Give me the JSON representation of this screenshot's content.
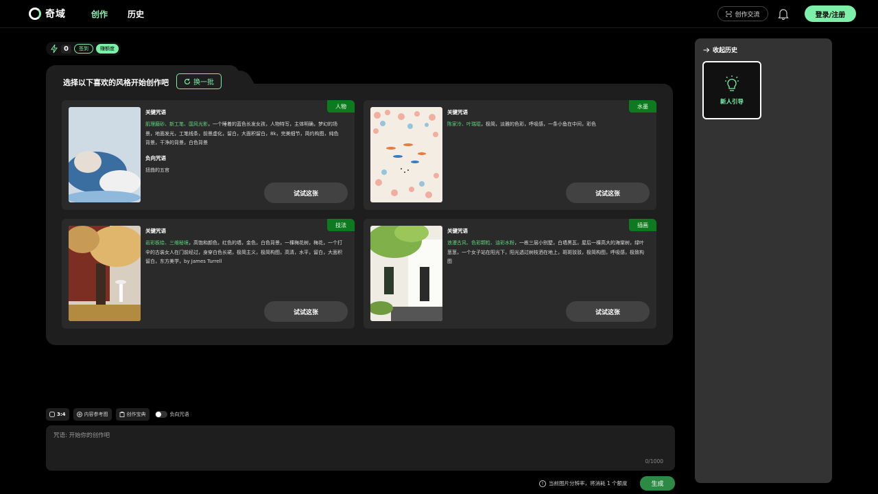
{
  "header": {
    "app_name": "奇域",
    "nav": [
      {
        "label": "创作"
      },
      {
        "label": "历史"
      }
    ],
    "exchange_label": "创作交流",
    "login_label": "登录/注册"
  },
  "credits": {
    "count": "0",
    "checkin_label": "签到",
    "quota_label": "赚额度"
  },
  "panel": {
    "title": "选择以下喜欢的风格开始创作吧",
    "refresh_label": "换一批",
    "cards": [
      {
        "tag": "人物",
        "keyword_label": "关键咒语",
        "keyword_highlight": "肌理磨砂、新工笔、国风光影",
        "keyword_text": "，一个睡着的蓝色长发女孩，人物特写，主体明确，梦幻的场景，地面发光，工笔线条，前景虚化，留白，大面积留白，8k，完美细节，简约构图，纯色背景，干净的背景，白色背景",
        "negative_label": "负向咒语",
        "negative_text": "扭曲的五官",
        "try_label": "试试这张"
      },
      {
        "tag": "水墨",
        "keyword_label": "关键咒语",
        "keyword_highlight": "陈家泠、叶瑞琨",
        "keyword_text": "，极简，淡雅的色彩，呼吸感，一条小鱼在中间，彩色",
        "try_label": "试试这张"
      },
      {
        "tag": "技法",
        "keyword_label": "关键咒语",
        "keyword_highlight": "岩彩板绘、三维秘境",
        "keyword_text": "，高饱和颜色，红色的墙，金色，白色背景，一棵梅花树，梅花，一个打伞的古装女人在门前经过，身穿白色长裙，极简主义，极简构图，高清，水平，留白，大面积留白，东方美学，by James Turrell",
        "try_label": "试试这张"
      },
      {
        "tag": "插画",
        "keyword_label": "关键咒语",
        "keyword_highlight": "浪漫古风、色彩颗粒、油彩水粉",
        "keyword_text": "，一栋三层小别墅，白墙黑瓦，屋后一棵高大的海棠树，绿叶葱葱，一个女子站在阳光下，阳光透过树枝洒在地上，斑斑驳驳，极简构图，呼吸感，极致构图",
        "try_label": "试试这张"
      }
    ]
  },
  "toolbar": {
    "ratio_label": "3:4",
    "reference_label": "内容参考图",
    "treasure_label": "创作宝典",
    "negative_toggle_label": "负向咒语"
  },
  "prompt": {
    "placeholder": "咒语: 开始你的创作吧",
    "char_count": "0/1000"
  },
  "footer": {
    "notice": "当前图片分辨率，将消耗 1 个额度",
    "generate_label": "生成"
  },
  "sidebar": {
    "collapse_label": "收起历史",
    "guide_label": "新人引导"
  },
  "colors": {
    "accent": "#7cf0a8",
    "tag_green": "#0e7a1f",
    "highlight": "#5fd67e"
  }
}
